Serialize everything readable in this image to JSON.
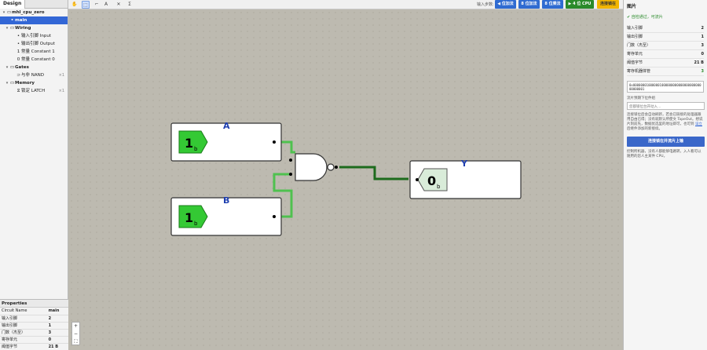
{
  "left": {
    "tab": "Design",
    "tree": [
      {
        "label": "mhl_cpu_zero",
        "arrow": "▾",
        "icon": "▭",
        "count": "",
        "bold": true,
        "sel": false,
        "indent": 2
      },
      {
        "label": "main",
        "arrow": "",
        "icon": "•",
        "count": "",
        "bold": true,
        "sel": true,
        "indent": 6
      },
      {
        "label": "Wiring",
        "arrow": "▾",
        "icon": "▭",
        "count": "",
        "bold": true,
        "sel": false,
        "indent": 6
      },
      {
        "label": "输入引脚 Input",
        "arrow": "",
        "icon": "•",
        "count": "",
        "bold": false,
        "sel": false,
        "indent": 14
      },
      {
        "label": "输出引脚 Output",
        "arrow": "",
        "icon": "•",
        "count": "",
        "bold": false,
        "sel": false,
        "indent": 14
      },
      {
        "label": "常量 Constant 1",
        "arrow": "",
        "icon": "1",
        "count": "",
        "bold": false,
        "sel": false,
        "indent": 14
      },
      {
        "label": "常量 Constant 0",
        "arrow": "",
        "icon": "0",
        "count": "",
        "bold": false,
        "sel": false,
        "indent": 14
      },
      {
        "label": "Gates",
        "arrow": "▾",
        "icon": "▭",
        "count": "",
        "bold": true,
        "sel": false,
        "indent": 6
      },
      {
        "label": "与非 NAND",
        "arrow": "",
        "icon": "⊃",
        "count": "×1",
        "bold": false,
        "sel": false,
        "indent": 14
      },
      {
        "label": "Memory",
        "arrow": "▾",
        "icon": "▭",
        "count": "",
        "bold": true,
        "sel": false,
        "indent": 6
      },
      {
        "label": "锁定 LATCH",
        "arrow": "",
        "icon": "⧖",
        "count": "×1",
        "bold": false,
        "sel": false,
        "indent": 14
      }
    ],
    "props_title": "Properties",
    "props": [
      {
        "k": "Circuit Name",
        "v": "main"
      },
      {
        "k": "输入引脚",
        "v": "2"
      },
      {
        "k": "输出引脚",
        "v": "1"
      },
      {
        "k": "门数（杰至）",
        "v": "3"
      },
      {
        "k": "寄存单元",
        "v": "0"
      },
      {
        "k": "阈值字节",
        "v": "21 B"
      }
    ]
  },
  "toolbar": {
    "tools": [
      {
        "name": "hand-tool",
        "glyph": "✋",
        "active": false
      },
      {
        "name": "select-tool",
        "glyph": "⬚",
        "active": true
      },
      {
        "name": "wire-tool",
        "glyph": "⌐",
        "active": false
      },
      {
        "name": "text-tool",
        "glyph": "A",
        "active": false
      },
      {
        "name": "delete-tool",
        "glyph": "✕",
        "active": false
      },
      {
        "name": "sigma-tool",
        "glyph": "Σ",
        "active": false
      }
    ],
    "input_mode_label": "输入步数:",
    "buttons": [
      {
        "name": "bit1-button",
        "label": "◀ 位加法",
        "color": "#2f6bd1"
      },
      {
        "name": "bit8-button",
        "label": "8 位加法",
        "color": "#2f6bd1"
      },
      {
        "name": "bitmul-button",
        "label": "8 位乘法",
        "color": "#2f6bd1"
      },
      {
        "name": "cpu4-button",
        "label": "▶ 4 位 CPU",
        "color": "#2a8a2a"
      },
      {
        "name": "connect-chip-button",
        "label": "连接锁在",
        "color": "#f2b600"
      }
    ]
  },
  "canvas": {
    "pins": {
      "A": "A",
      "B": "B",
      "Y": "Y"
    },
    "values": {
      "A": "1",
      "B": "1",
      "Y": "0"
    },
    "subscript": "b",
    "zoom": {
      "in": "+",
      "out": "−",
      "fit": "⛶"
    }
  },
  "right": {
    "title": "图片",
    "ok": "✔ 自检通过，可流片",
    "stats": [
      {
        "k": "输入引脚",
        "v": "2",
        "green": false
      },
      {
        "k": "输出引脚",
        "v": "1",
        "green": false
      },
      {
        "k": "门数（杰至）",
        "v": "3",
        "green": false
      },
      {
        "k": "寄存单元",
        "v": "0",
        "green": false
      },
      {
        "k": "阈值字节",
        "v": "21 B",
        "green": false
      },
      {
        "k": "寄存机器体管",
        "v": "3",
        "green": true
      }
    ],
    "bits": "0x00000001000000100000000000000000000000000001",
    "chip_label": "流片预期下位件组",
    "chip_placeholder": "您都锁位台开动入…",
    "note1": "连接锁位后会自动刷新，若会已链接的处理器跟用自由已得；没有就默认所使文 TapeOut。想说片刻前先，数据优选里的地址即可，也可到",
    "note1_link": "设立",
    "note1_tail": "后继件添加的新接续。",
    "connect_btn": "连接锁在并流片上输",
    "note2": "控制所机器，没有人都能够电路转，入人看可以随用的您人主某件 CPU。"
  }
}
